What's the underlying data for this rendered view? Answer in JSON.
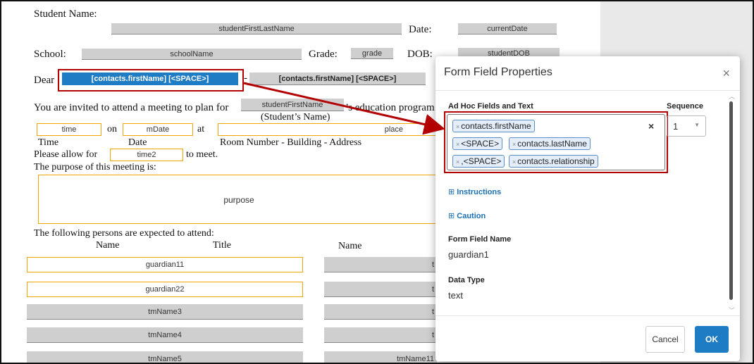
{
  "doc": {
    "student_name_label": "Student Name:",
    "student_name_field": "studentFirstLastName",
    "date_label": "Date:",
    "date_field": "currentDate",
    "school_label": "School:",
    "school_field": "schoolName",
    "grade_label": "Grade:",
    "grade_field": "grade",
    "dob_label": "DOB:",
    "dob_field": "studentDOB",
    "dear_label": "Dear",
    "dear_field_selected": "[contacts.firstName] [<SPACE>]",
    "dash": "-",
    "dear_field2": "[contacts.firstName] [<SPACE>]",
    "invited_text": "You are invited to attend a meeting to plan for",
    "invited_field": "studentFirstName",
    "program_text": "’s education program",
    "students_name_caption": "(Student’s Name)",
    "time_field": "time",
    "on_text": "on",
    "mdate_field": "mDate",
    "at_text": "at",
    "place_field": "place",
    "time_caption": "Time",
    "date_caption": "Date",
    "room_caption": "Room Number - Building - Address",
    "allow_text": "Please allow for",
    "time2_field": "time2",
    "to_meet_text": "to meet.",
    "purpose_text": "The purpose of this meeting is:",
    "purpose_field": "purpose",
    "following_text": "The following persons are expected to attend:",
    "col_name": "Name",
    "col_title": "Title",
    "col_name2": "Name",
    "rows": [
      {
        "name": "guardian11",
        "right": "t"
      },
      {
        "name": "guardian22",
        "right": "t"
      },
      {
        "name": "tmName3",
        "right": "t"
      },
      {
        "name": "tmName4",
        "right": "t"
      },
      {
        "name": "tmName5",
        "right": "tmName11"
      }
    ]
  },
  "modal": {
    "title": "Form Field Properties",
    "close": "×",
    "adhoc_label": "Ad Hoc Fields and Text",
    "sequence_label": "Sequence",
    "sequence_value": "1",
    "tokens": [
      "contacts.firstName",
      "<SPACE>",
      "contacts.lastName",
      ",<SPACE>",
      "contacts.relationship"
    ],
    "token_x": "×",
    "clear": "×",
    "instructions_link": "Instructions",
    "caution_link": "Caution",
    "form_field_name_label": "Form Field Name",
    "form_field_name_value": "guardian1",
    "data_type_label": "Data Type",
    "data_type_value": "text",
    "cancel_label": "Cancel",
    "ok_label": "OK"
  },
  "colors": {
    "accent": "#1e7cc4",
    "highlight": "#b30000",
    "field_gray": "#cfcfcf",
    "field_orange": "#f0a500"
  }
}
